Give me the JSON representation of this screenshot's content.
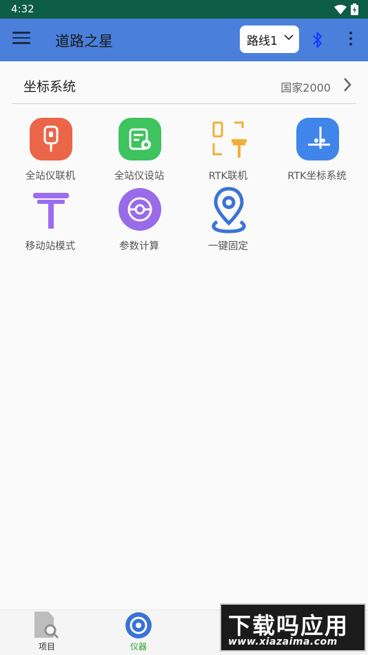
{
  "status_bar": {
    "time": "4:32"
  },
  "app_bar": {
    "title": "道路之星",
    "route_select": "路线1"
  },
  "coord_system": {
    "title": "坐标系统",
    "value": "国家2000"
  },
  "tiles": [
    {
      "label": "全站仪联机",
      "icon": "total-station-link-icon",
      "color": "#e9604a"
    },
    {
      "label": "全站仪设站",
      "icon": "total-station-setup-icon",
      "color": "#3dbf5f"
    },
    {
      "label": "RTK联机",
      "icon": "rtk-connect-icon",
      "color": "#f1b035"
    },
    {
      "label": "RTK坐标系统",
      "icon": "rtk-coordinate-icon",
      "color": "#3f82e6"
    },
    {
      "label": "移动站模式",
      "icon": "rover-mode-icon",
      "color": "#9b6df0"
    },
    {
      "label": "参数计算",
      "icon": "parameter-calc-icon",
      "color": "#9b6df0"
    },
    {
      "label": "一键固定",
      "icon": "location-pin-icon",
      "color": "#3a73d6"
    }
  ],
  "bottom_nav": {
    "items": [
      {
        "label": "项目",
        "icon": "project-icon",
        "active": false
      },
      {
        "label": "仪器",
        "icon": "instrument-icon",
        "active": true
      }
    ],
    "active_color": "#2a9d2a",
    "inactive_color": "#333333"
  },
  "watermark": {
    "line1": "下载吗应用",
    "line2": "www.xiazaima.com"
  }
}
